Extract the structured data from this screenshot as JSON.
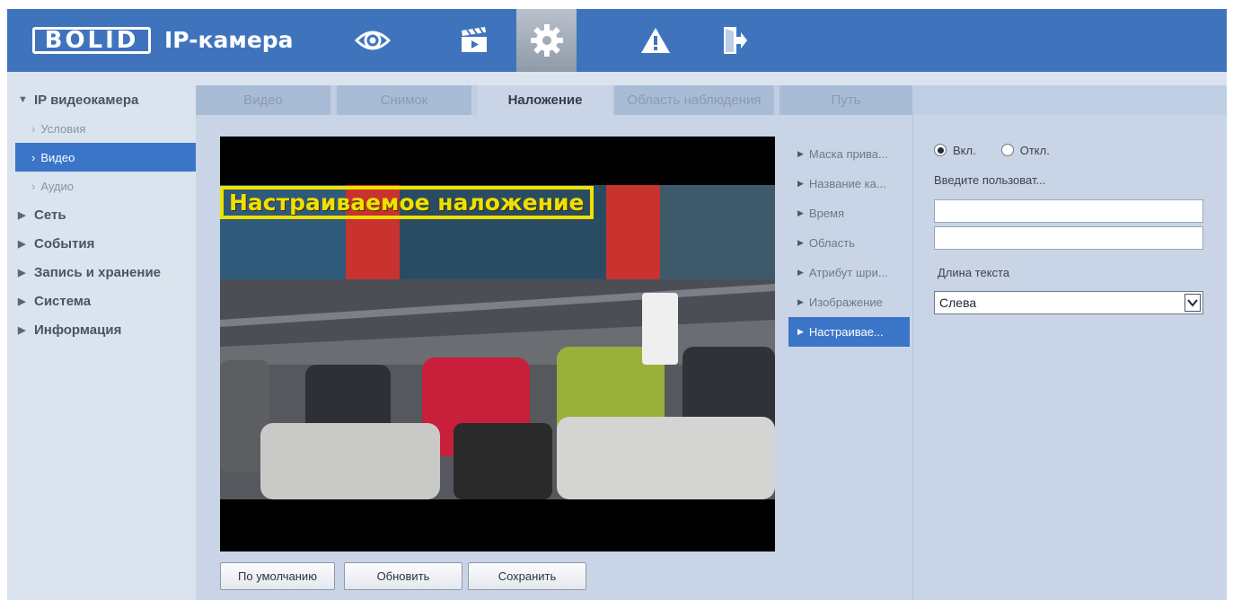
{
  "header": {
    "logo": "BOLID",
    "product": "IP-камера",
    "nav": [
      {
        "icon": "eye-icon"
      },
      {
        "icon": "clapperboard-icon"
      },
      {
        "icon": "gear-icon",
        "active": true
      },
      {
        "icon": "warning-icon"
      },
      {
        "icon": "exit-icon"
      }
    ]
  },
  "sidebar": {
    "groups": [
      {
        "label": "IP видеокамера",
        "expanded": true
      },
      {
        "label": "Сеть"
      },
      {
        "label": "События"
      },
      {
        "label": "Запись и хранение"
      },
      {
        "label": "Система"
      },
      {
        "label": "Информация"
      }
    ],
    "sub_items": [
      {
        "label": "Условия"
      },
      {
        "label": "Видео",
        "active": true
      },
      {
        "label": "Аудио"
      }
    ]
  },
  "tabs": [
    {
      "label": "Видео"
    },
    {
      "label": "Снимок"
    },
    {
      "label": "Наложение",
      "active": true
    },
    {
      "label": "Область наблюдения"
    },
    {
      "label": "Путь"
    }
  ],
  "preview": {
    "overlay_text": "Настраиваемое наложение"
  },
  "buttons": {
    "default": "По умолчанию",
    "refresh": "Обновить",
    "save": "Сохранить"
  },
  "overlay_menu": [
    {
      "label": "Маска прива..."
    },
    {
      "label": "Название ка..."
    },
    {
      "label": "Время"
    },
    {
      "label": "Область"
    },
    {
      "label": "Атрибут шри..."
    },
    {
      "label": "Изображение"
    },
    {
      "label": "Настраивае...",
      "active": true
    }
  ],
  "settings": {
    "radio_on": "Вкл.",
    "radio_off": "Откл.",
    "selected": "Вкл.",
    "input_label": "Введите пользоват...",
    "input1_value": "",
    "input2_value": "",
    "length_label": "Длина текста",
    "align_select": "Слева"
  },
  "colors": {
    "header_bg": "#3f74bd",
    "accent": "#3a75c8",
    "panel_bg": "#c9d5e6",
    "overlay_text": "#f0e000"
  }
}
